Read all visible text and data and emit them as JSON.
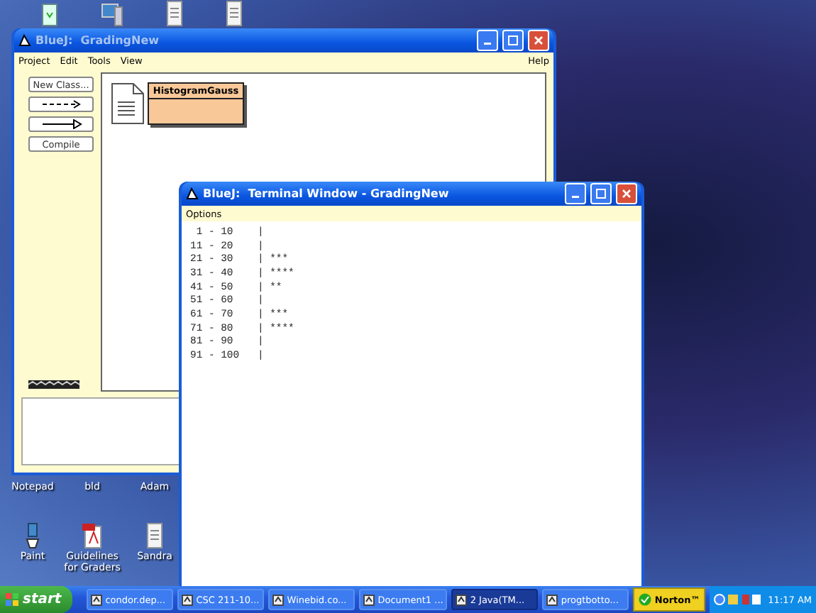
{
  "desktop_icons": [
    {
      "kind": "recycle"
    },
    {
      "kind": "computer"
    },
    {
      "kind": "document"
    },
    {
      "kind": "document"
    },
    {
      "label": "Notepad"
    },
    {
      "label": "bld"
    },
    {
      "label": "Adam"
    },
    {
      "kind": "paint",
      "label": "Paint"
    },
    {
      "kind": "pdf",
      "label": "Guidelines for Graders"
    },
    {
      "kind": "document",
      "label": "Sandra"
    }
  ],
  "main_window": {
    "title": "BlueJ:  GradingNew",
    "menu": [
      "Project",
      "Edit",
      "Tools",
      "View"
    ],
    "help": "Help",
    "tool_buttons": [
      {
        "kind": "text",
        "label": "New Class..."
      },
      {
        "kind": "dashed-arrow"
      },
      {
        "kind": "solid-arrow"
      },
      {
        "kind": "text",
        "label": "Compile"
      }
    ],
    "classes": [
      {
        "name": "HistogramGauss"
      }
    ]
  },
  "terminal": {
    "title": "BlueJ:  Terminal Window - GradingNew",
    "menu": [
      "Options"
    ],
    "lines": [
      " 1 - 10    |",
      "11 - 20    |",
      "21 - 30    | ***",
      "31 - 40    | ****",
      "41 - 50    | **",
      "51 - 60    |",
      "61 - 70    | ***",
      "71 - 80    | ****",
      "81 - 90    |",
      "91 - 100   |"
    ]
  },
  "taskbar": {
    "start": "start",
    "tasks": [
      {
        "label": "condor.dep...",
        "selected": false
      },
      {
        "label": "CSC 211-10...",
        "selected": false
      },
      {
        "label": "Winebid.co...",
        "selected": false
      },
      {
        "label": "Document1 ...",
        "selected": false
      },
      {
        "label": "2 Java(TM...",
        "selected": true
      },
      {
        "label": "progtbotto...",
        "selected": false
      }
    ],
    "norton": "Norton™",
    "clock": "11:17 AM"
  }
}
